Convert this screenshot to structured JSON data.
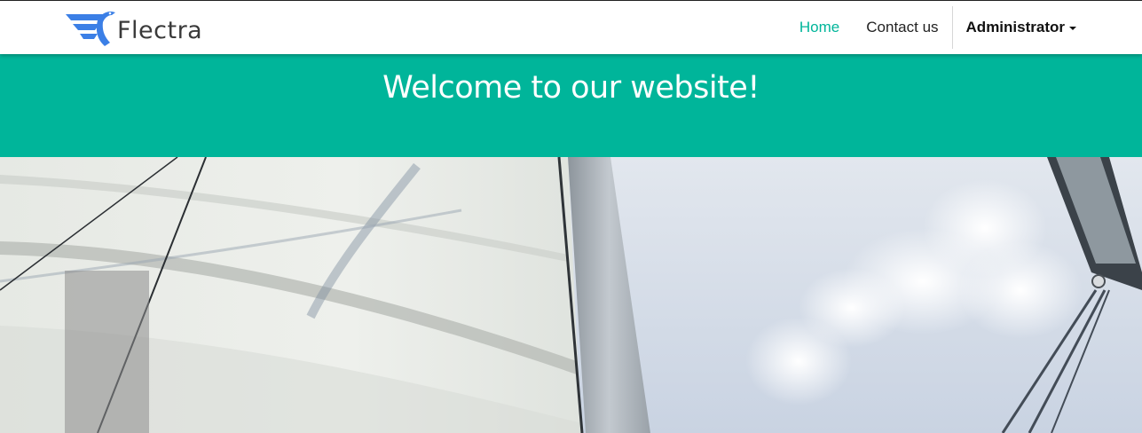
{
  "header": {
    "brand": "Flectra",
    "logo_icon": "bird-logo-icon",
    "nav": [
      {
        "label": "Home",
        "active": true
      },
      {
        "label": "Contact us",
        "active": false
      }
    ],
    "user": {
      "label": "Administrator",
      "icon": "caret-down-icon"
    }
  },
  "banner": {
    "title": "Welcome to our website!",
    "background_color": "#00b59a"
  },
  "hero": {
    "image_icon": "sailboat-photo"
  },
  "colors": {
    "accent": "#00b59a",
    "logo_blue": "#3b7fe6",
    "text": "#222222"
  }
}
